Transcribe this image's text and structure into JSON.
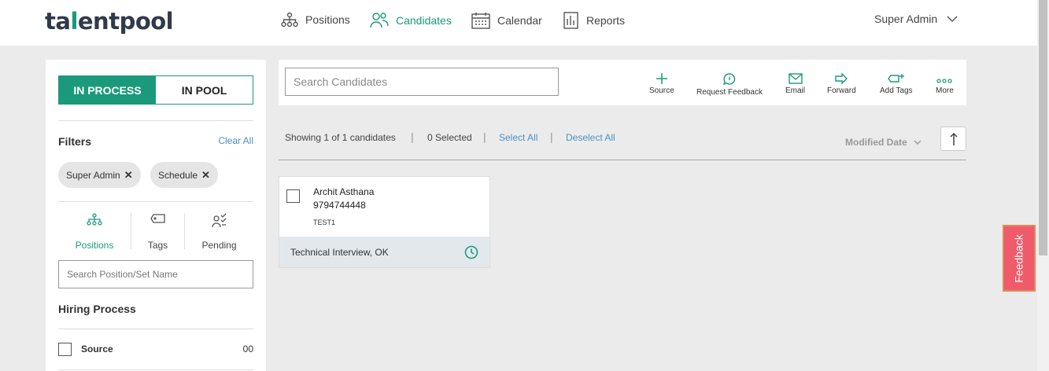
{
  "header": {
    "logo_prefix": "ta",
    "logo_accent": "l",
    "logo_suffix": "entpool",
    "nav": [
      {
        "label": "Positions",
        "icon": "hierarchy-icon",
        "active": false
      },
      {
        "label": "Candidates",
        "icon": "people-icon",
        "active": true
      },
      {
        "label": "Calendar",
        "icon": "calendar-icon",
        "active": false
      },
      {
        "label": "Reports",
        "icon": "report-icon",
        "active": false
      }
    ],
    "user": "Super Admin"
  },
  "sidebar": {
    "toggle": {
      "active": "IN PROCESS",
      "inactive": "IN POOL"
    },
    "filters_title": "Filters",
    "clear_all": "Clear All",
    "chips": [
      "Super Admin",
      "Schedule"
    ],
    "tabs": [
      {
        "label": "Positions",
        "icon": "hierarchy-icon",
        "active": true
      },
      {
        "label": "Tags",
        "icon": "tag-icon",
        "active": false
      },
      {
        "label": "Pending",
        "icon": "pending-icon",
        "active": false
      }
    ],
    "search_placeholder": "Search Position/Set Name",
    "hiring_title": "Hiring Process",
    "stages": [
      {
        "label": "Source",
        "count": "00"
      }
    ]
  },
  "toolbar": {
    "search_placeholder": "Search Candidates",
    "actions": [
      {
        "label": "Source",
        "icon": "plus-icon"
      },
      {
        "label": "Request Feedback",
        "icon": "feedback-request-icon"
      },
      {
        "label": "Email",
        "icon": "email-icon"
      },
      {
        "label": "Forward",
        "icon": "forward-icon"
      },
      {
        "label": "Add Tags",
        "icon": "add-tag-icon"
      },
      {
        "label": "More",
        "icon": "more-icon"
      }
    ]
  },
  "results": {
    "showing": "Showing 1 of 1 candidates",
    "selected": "0 Selected",
    "select_all": "Select All",
    "deselect_all": "Deselect All",
    "sort_label": "Modified Date"
  },
  "candidates": [
    {
      "name": "Archit Asthana",
      "phone": "9794744448",
      "tag": "TEST1",
      "stage": "Technical Interview, OK"
    }
  ],
  "feedback_tab": "Feedback",
  "colors": {
    "accent": "#1a9a7b",
    "link": "#4a90c8",
    "feedback": "#ef5b6a"
  }
}
